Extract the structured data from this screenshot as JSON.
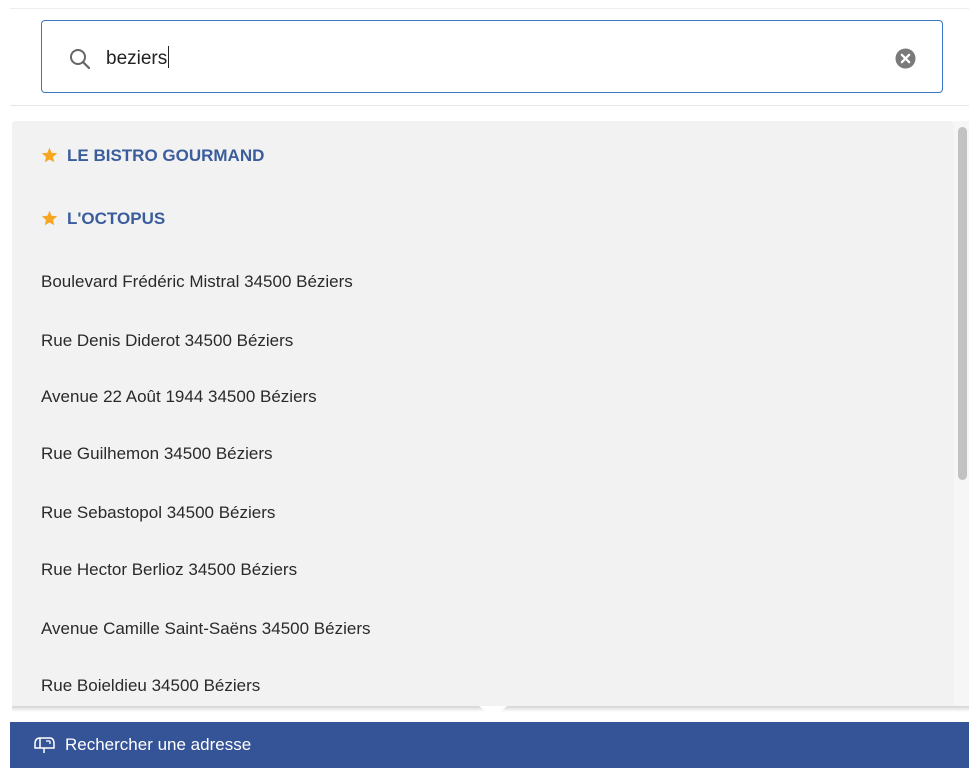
{
  "search": {
    "value": "beziers",
    "clear_icon": "clear-circle-x-icon",
    "search_icon": "magnifier-icon"
  },
  "suggestions": {
    "favorites": [
      {
        "label": "LE BISTRO GOURMAND",
        "icon": "star-icon"
      },
      {
        "label": "L'OCTOPUS",
        "icon": "star-icon"
      }
    ],
    "addresses": [
      "Boulevard Frédéric Mistral 34500 Béziers",
      "Rue Denis Diderot 34500 Béziers",
      "Avenue 22 Août 1944 34500 Béziers",
      "Rue Guilhemon 34500 Béziers",
      "Rue Sebastopol 34500 Béziers",
      "Rue Hector Berlioz 34500 Béziers",
      "Avenue Camille Saint-Saëns 34500 Béziers",
      "Rue Boieldieu 34500 Béziers"
    ]
  },
  "bottom_bar": {
    "label": "Rechercher une adresse",
    "icon": "mailbox-icon"
  },
  "colors": {
    "accent": "#3a75c4",
    "favorite_text": "#3b5d9c",
    "star": "#f5a623",
    "bottom_bar": "#355397",
    "dropdown_bg": "#f2f2f2"
  }
}
